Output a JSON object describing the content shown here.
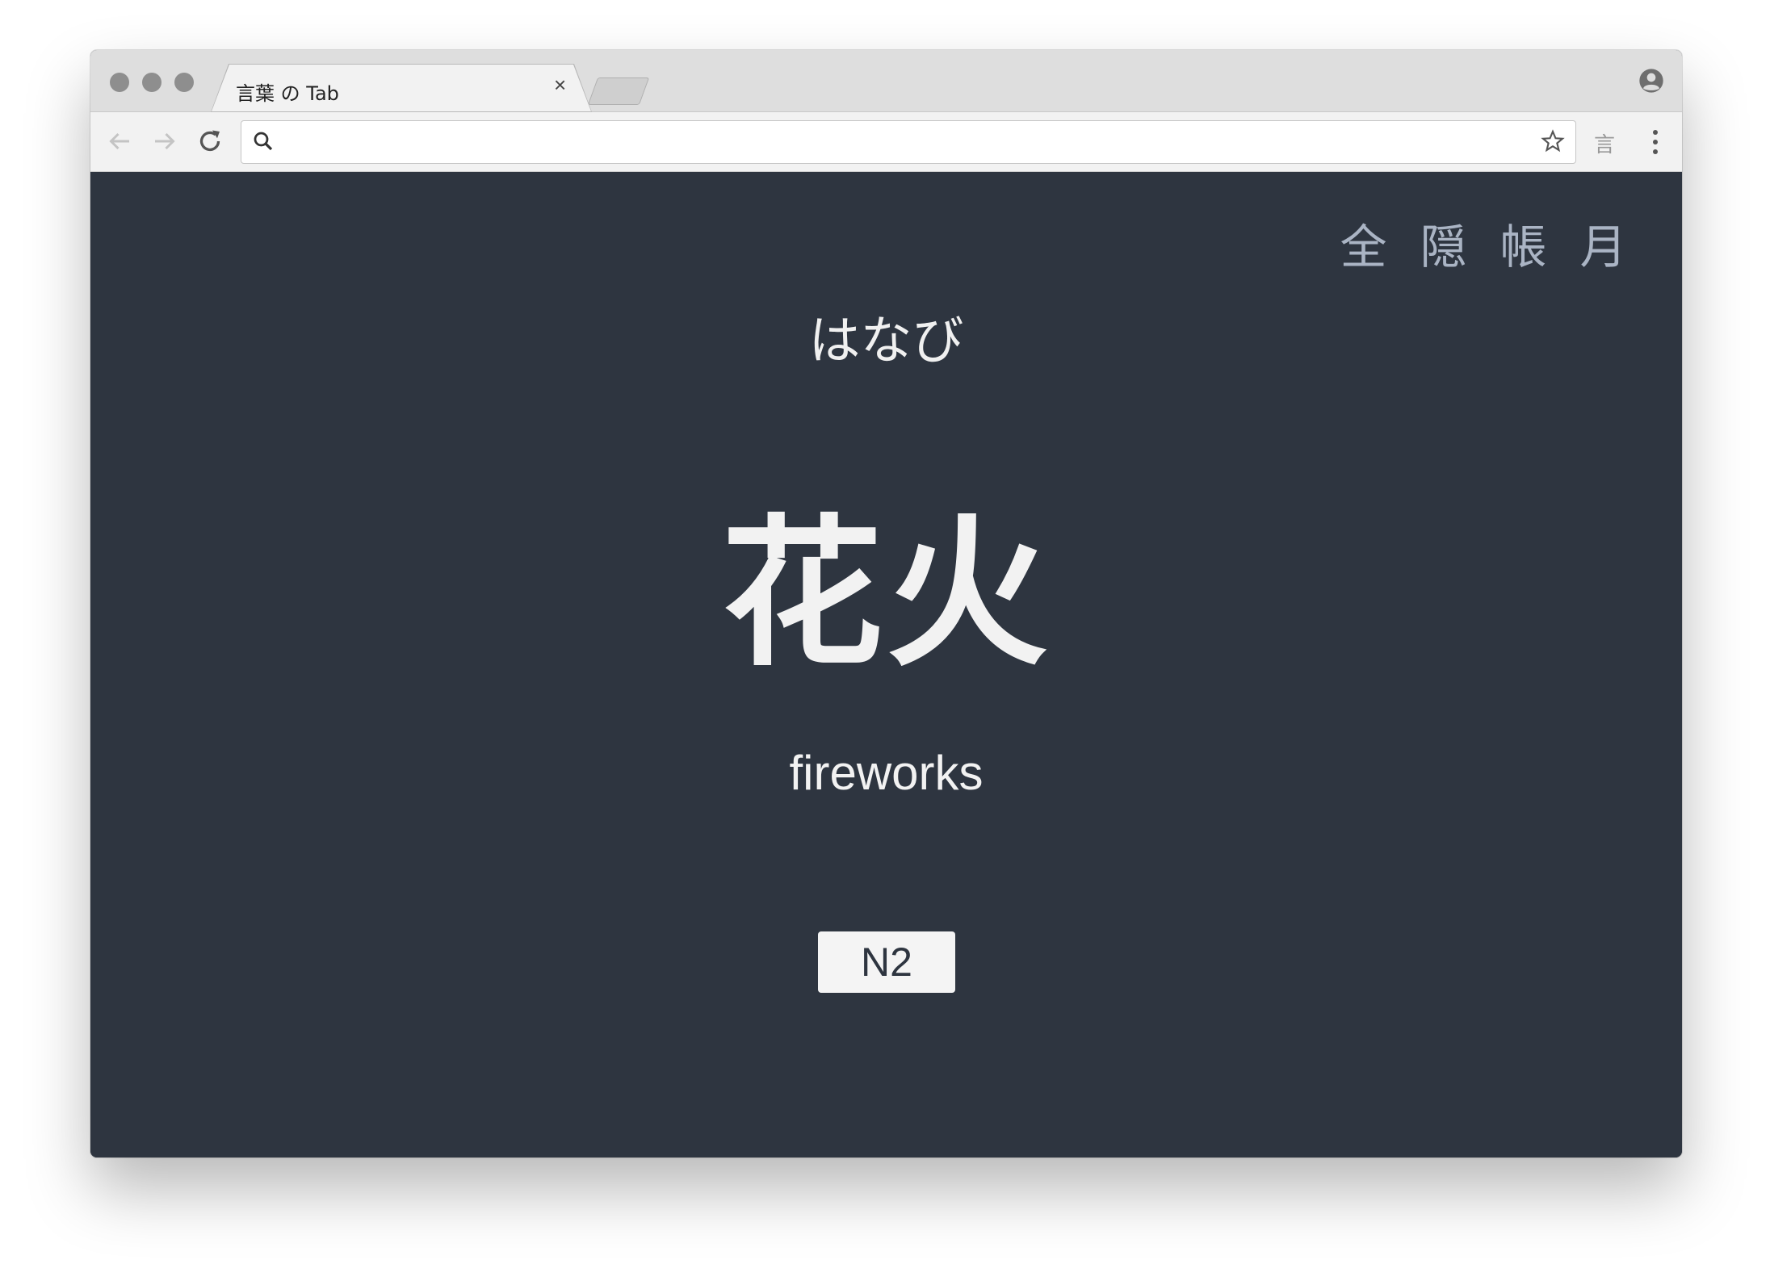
{
  "browser": {
    "tab_title": "言葉 の Tab",
    "tab_close": "×",
    "address_value": "",
    "extension_label": "言"
  },
  "nav": {
    "items": [
      "全",
      "隠",
      "帳",
      "月"
    ]
  },
  "card": {
    "reading": "はなび",
    "kanji": "花火",
    "meaning": "fireworks",
    "level": "N2"
  },
  "colors": {
    "background": "#2e3540",
    "text": "#f2f2f2",
    "nav_text": "#aab4c4",
    "badge_bg": "#f4f4f4"
  }
}
